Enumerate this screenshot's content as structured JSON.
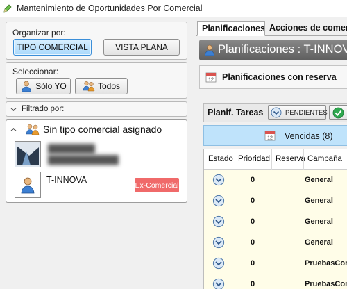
{
  "window": {
    "title": "Mantenimiento de Oportunidades Por Comercial"
  },
  "organize": {
    "label": "Organizar por:",
    "tipo_comercial": "TIPO COMERCIAL",
    "vista_plana": "VISTA PLANA"
  },
  "select": {
    "label": "Seleccionar:",
    "solo_yo": "Sólo YO",
    "todos": "Todos"
  },
  "filter": {
    "label": "Filtrado por:"
  },
  "group": {
    "title": "Sin tipo comercial asignado",
    "items": [
      {
        "name_line1": "████████",
        "name_line2": "████████████",
        "badge": ""
      },
      {
        "name": "T-INNOVA",
        "badge": "Ex-Comercial"
      }
    ]
  },
  "tabs": [
    {
      "label": "Planificaciones",
      "active": true
    },
    {
      "label": "Acciones de comercio",
      "active": false
    }
  ],
  "planificaciones": {
    "header": "Planificaciones : T-INNOVA",
    "reserva": "Planificaciones con reserva"
  },
  "tasks": {
    "label": "Planif. Tareas",
    "pendientes": "PENDIENTES",
    "vencidas": "Vencidas (8)"
  },
  "grid": {
    "columns": [
      "Estado",
      "Prioridad",
      "Reserva",
      "Campaña"
    ],
    "rows": [
      {
        "prioridad": "0",
        "reserva": "",
        "campana": "General"
      },
      {
        "prioridad": "0",
        "reserva": "",
        "campana": "General"
      },
      {
        "prioridad": "0",
        "reserva": "",
        "campana": "General"
      },
      {
        "prioridad": "0",
        "reserva": "",
        "campana": "General"
      },
      {
        "prioridad": "0",
        "reserva": "",
        "campana": "PruebasCom"
      },
      {
        "prioridad": "0",
        "reserva": "",
        "campana": "PruebasCom"
      }
    ]
  },
  "colors": {
    "accent_blue": "#bfe3fb",
    "active_button": "#a9d8fb",
    "badge_red": "#f06a6a",
    "header_gray": "#6e6e6e",
    "row_yellow": "#fffde8"
  },
  "icons": {
    "app": "pencil-icon",
    "user": "user-icon",
    "users": "users-icon",
    "calendar": "calendar-icon",
    "chevron": "chevron-down-icon",
    "status": "chevron-down-circle-icon",
    "check": "check-circle-icon"
  }
}
